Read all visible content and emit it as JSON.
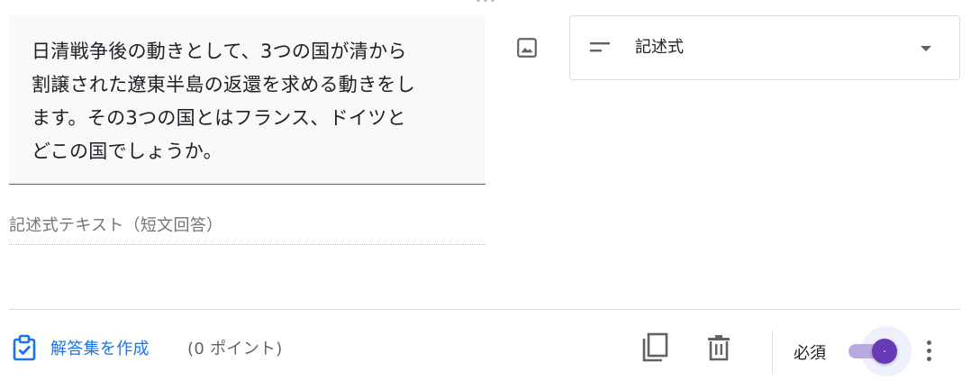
{
  "question": {
    "text_lines": [
      "日清戦争後の動きとして、3つの国が清から",
      "割譲された遼東半島の返還を求める動きをし",
      "ます。その3つの国とはフランス、ドイツと",
      "どこの国でしょうか。"
    ]
  },
  "question_type": {
    "selected": "記述式",
    "icon": "short-text-icon"
  },
  "answer_preview": {
    "placeholder": "記述式テキスト（短文回答）"
  },
  "footer": {
    "answer_key_label": "解答集を作成",
    "points_label": "(0 ポイント)",
    "required_label": "必須",
    "required_on": true
  },
  "colors": {
    "accent": "#673ab7",
    "link": "#1a73e8",
    "question_bg": "#f8f9fa",
    "icon": "#5f6368"
  },
  "icons": {
    "image": "image-icon",
    "answer_key": "assignment-check-icon",
    "duplicate": "copy-icon",
    "delete": "trash-icon",
    "more": "more-vert-icon",
    "drag": "drag-handle-icon",
    "dropdown": "chevron-down-icon"
  }
}
